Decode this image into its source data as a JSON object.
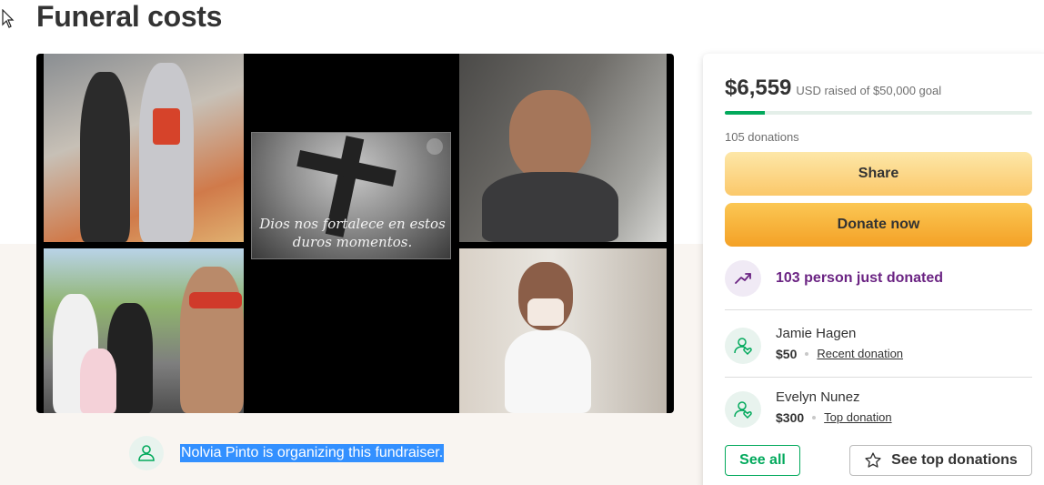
{
  "campaign": {
    "title": "Funeral costs",
    "image_caption": "Dios nos fortalece en estos duros momentos.",
    "organizer_text": "Nolvia Pinto is organizing this fundraiser."
  },
  "sidebar": {
    "raised_amount": "$6,559",
    "raised_suffix": "USD raised of $50,000 goal",
    "progress_fraction": 0.131,
    "donation_count": "105 donations",
    "share_label": "Share",
    "donate_label": "Donate now",
    "recent_activity": "103 person just donated",
    "donors": [
      {
        "name": "Jamie Hagen",
        "amount": "$50",
        "tag": "Recent donation"
      },
      {
        "name": "Evelyn Nunez",
        "amount": "$300",
        "tag": "Top donation"
      }
    ],
    "see_all_label": "See all",
    "see_top_label": "See top donations"
  },
  "colors": {
    "accent_green": "#02a95c",
    "purple": "#6b2483",
    "button_yellow": "#fbc86a",
    "button_orange": "#f4a126",
    "selection_blue": "#3390ff"
  },
  "icons": [
    "cursor-icon",
    "expand-icon",
    "organizer-icon",
    "trend-up-icon",
    "donor-icon",
    "star-icon"
  ]
}
